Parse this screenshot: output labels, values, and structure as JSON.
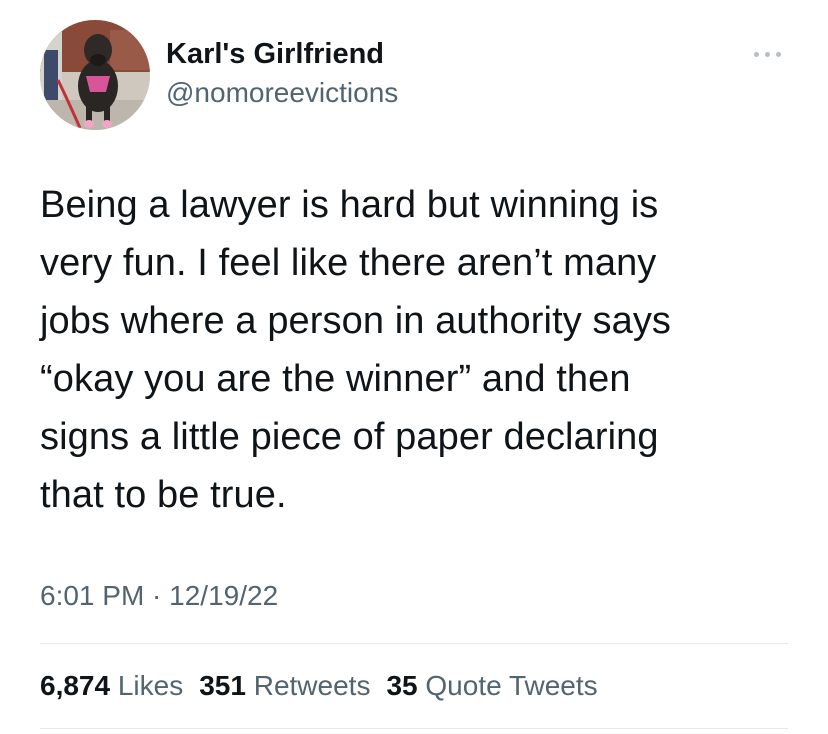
{
  "author": {
    "display_name": "Karl's Girlfriend",
    "handle": "@nomoreevictions",
    "avatar_icon": "dog-photo-avatar"
  },
  "tweet": {
    "text": "Being a lawyer is hard but winning is\nvery fun. I feel like there aren’t many\njobs where a person in authority says\n“okay you are the winner” and then\nsigns a little piece of paper declaring\nthat to be true.",
    "timestamp": "6:01 PM · 12/19/22"
  },
  "stats": {
    "likes_count": "6,874",
    "likes_label": "Likes",
    "retweets_count": "351",
    "retweets_label": "Retweets",
    "quotes_count": "35",
    "quotes_label": "Quote Tweets"
  },
  "colors": {
    "text_primary": "#0f1419",
    "text_secondary": "#536471",
    "divider": "#e6e9eb"
  },
  "icons": {
    "more": "more-options-icon"
  }
}
